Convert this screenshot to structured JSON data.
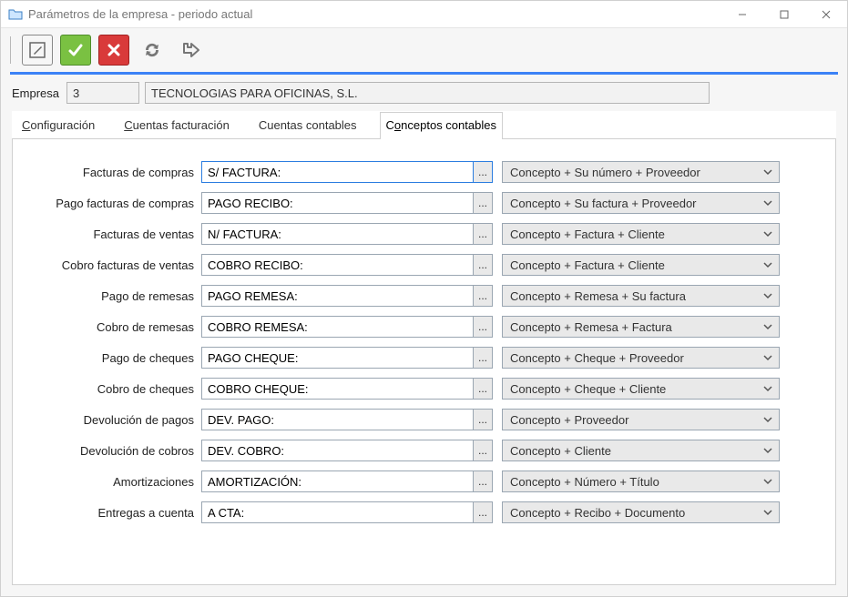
{
  "window": {
    "title": "Parámetros de la empresa - periodo actual"
  },
  "company": {
    "label": "Empresa",
    "code": "3",
    "name": "TECNOLOGIAS PARA OFICINAS, S.L."
  },
  "tabs": {
    "config_pre": "C",
    "config_post": "onfiguración",
    "cuentasfact_pre": "C",
    "cuentasfact_post": "uentas facturación",
    "cuentascont": "Cuentas contables",
    "conceptos_pre": "C",
    "conceptos_mn": "o",
    "conceptos_post": "nceptos contables"
  },
  "rows": [
    {
      "label": "Facturas de compras",
      "value": "S/ FACTURA:",
      "option": "Concepto + Su número + Proveedor"
    },
    {
      "label": "Pago facturas de compras",
      "value": "PAGO RECIBO:",
      "option": "Concepto + Su factura + Proveedor"
    },
    {
      "label": "Facturas de ventas",
      "value": "N/ FACTURA:",
      "option": "Concepto + Factura + Cliente"
    },
    {
      "label": "Cobro facturas de ventas",
      "value": "COBRO RECIBO:",
      "option": "Concepto + Factura + Cliente"
    },
    {
      "label": "Pago de remesas",
      "value": "PAGO REMESA:",
      "option": "Concepto + Remesa + Su factura"
    },
    {
      "label": "Cobro de remesas",
      "value": "COBRO REMESA:",
      "option": "Concepto + Remesa + Factura"
    },
    {
      "label": "Pago de cheques",
      "value": "PAGO CHEQUE:",
      "option": "Concepto + Cheque + Proveedor"
    },
    {
      "label": "Cobro de cheques",
      "value": "COBRO CHEQUE:",
      "option": "Concepto + Cheque + Cliente"
    },
    {
      "label": "Devolución de pagos",
      "value": "DEV. PAGO:",
      "option": "Concepto + Proveedor"
    },
    {
      "label": "Devolución de cobros",
      "value": "DEV. COBRO:",
      "option": "Concepto + Cliente"
    },
    {
      "label": "Amortizaciones",
      "value": "AMORTIZACIÓN:",
      "option": "Concepto + Número + Título"
    },
    {
      "label": "Entregas a cuenta",
      "value": "A CTA:",
      "option": "Concepto + Recibo + Documento"
    }
  ],
  "lookup_label": "..."
}
